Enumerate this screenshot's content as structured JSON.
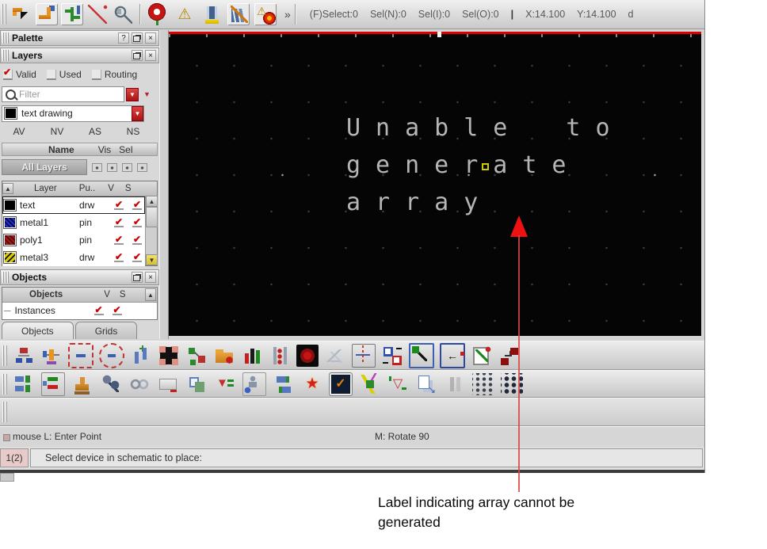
{
  "top_toolbar": {
    "group1_icons": [
      "select-mode-icon",
      "create-route-icon",
      "tree-route-icon",
      "probe-icon",
      "search-tools-icon"
    ],
    "group2_icons": [
      "stop-icon",
      "check-warnings-icon",
      "lamp-icon",
      "annotate-books-icon",
      "fire-warning-icon"
    ],
    "overflow_label": "»",
    "status": {
      "fselect": "(F)Select:0",
      "sel_n": "Sel(N):0",
      "sel_i": "Sel(I):0",
      "sel_o": "Sel(O):0",
      "divider": "|",
      "x": "X:14.100",
      "y": "Y:14.100",
      "trail": "d"
    }
  },
  "palette": {
    "title": "Palette",
    "help_label": "?",
    "layers": {
      "title": "Layers",
      "checkboxes": [
        {
          "label": "Valid",
          "checked": true
        },
        {
          "label": "Used",
          "checked": false
        },
        {
          "label": "Routing",
          "checked": false
        }
      ],
      "filter_placeholder": "Filter",
      "active_layer": "text drawing",
      "set_buttons": [
        "AV",
        "NV",
        "AS",
        "NS"
      ],
      "columns": {
        "name": "Name",
        "vis": "Vis",
        "sel": "Sel"
      },
      "all_layers_label": "All Layers",
      "table": {
        "headers": [
          "Layer",
          "Pu..",
          "V",
          "S"
        ],
        "rows": [
          {
            "name": "text",
            "purpose": "drw",
            "swatch": "black",
            "selected": true
          },
          {
            "name": "metal1",
            "purpose": "pin",
            "swatch": "metal1",
            "selected": false
          },
          {
            "name": "poly1",
            "purpose": "pin",
            "swatch": "poly1",
            "selected": false
          },
          {
            "name": "metal3",
            "purpose": "drw",
            "swatch": "metal3",
            "selected": false
          }
        ]
      }
    },
    "objects": {
      "title": "Objects",
      "headers": [
        "Objects",
        "V",
        "S"
      ],
      "rows": [
        {
          "name": "Instances"
        }
      ]
    },
    "tabs": [
      {
        "label": "Objects",
        "active": true
      },
      {
        "label": "Grids",
        "active": false
      }
    ]
  },
  "canvas": {
    "message_lines": [
      "Unable to",
      "generate",
      "array"
    ]
  },
  "toolbar_row1_icons": [
    "hierarchy-icon",
    "instance-pin-icon",
    "array-box-icon",
    "array-ring-icon",
    "pins-icon",
    "contact-icon",
    "reshape-icon",
    "open-folder-icon",
    "bars-icon",
    "ladder-icon",
    "globe-icon",
    "sketch-icon",
    "crosshair-icon",
    "swap-views-icon",
    "select-area-icon",
    "back-box-icon",
    "edit-properties-icon",
    "swap-red-icon"
  ],
  "toolbar_row2_icons": [
    "align-rows-icon",
    "box-rows-icon",
    "stamp-icon",
    "tools-icon",
    "chain-icon",
    "mail-route-icon",
    "cards-icon",
    "funnel-icon",
    "person-box-icon",
    "capsules-icon",
    "burst-icon",
    "screen-check-icon",
    "wire-lightning-icon",
    "triangle-arrows-icon",
    "page-copy-icon",
    "gray-bars-icon",
    "grid-dots-icon",
    "grid-matrix-icon"
  ],
  "status_bar": {
    "mouse": "mouse L: Enter Point",
    "middle": "M: Rotate 90"
  },
  "prompt_bar": {
    "badge": "1(2)",
    "message": "Select device in schematic to place:"
  },
  "annotation": {
    "text": "Label indicating array cannot be generated"
  },
  "colors": {
    "accent_red": "#bb2222",
    "canvas_bg": "#050505",
    "canvas_text": "#b5b5b5",
    "arrow_red": "#ee1111",
    "toolbar_gray": "#d4d4d4"
  }
}
